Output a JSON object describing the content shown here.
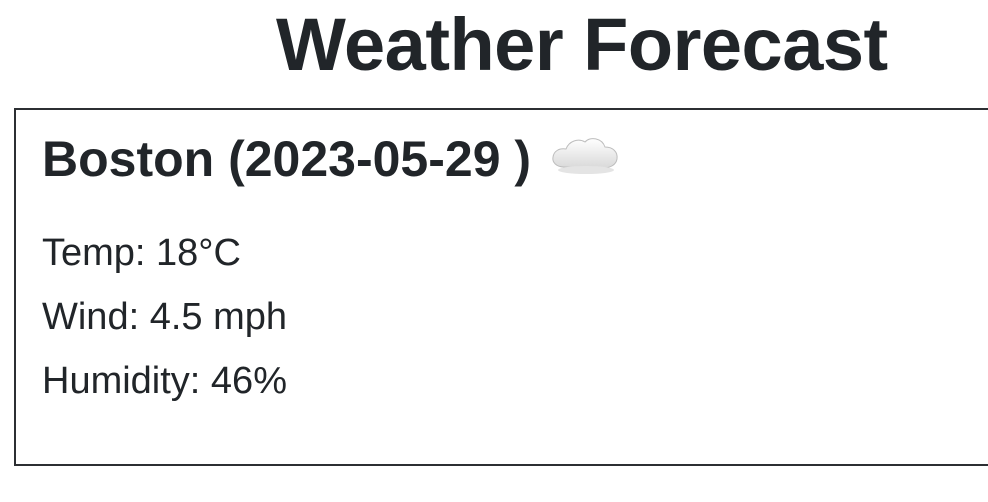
{
  "page": {
    "title": "Weather Forecast"
  },
  "forecast": {
    "city_date": "Boston (2023-05-29 )",
    "weather_icon": "cloud-icon",
    "temp": "Temp: 18°C",
    "wind": "Wind: 4.5 mph",
    "humidity": "Humidity: 46%"
  }
}
